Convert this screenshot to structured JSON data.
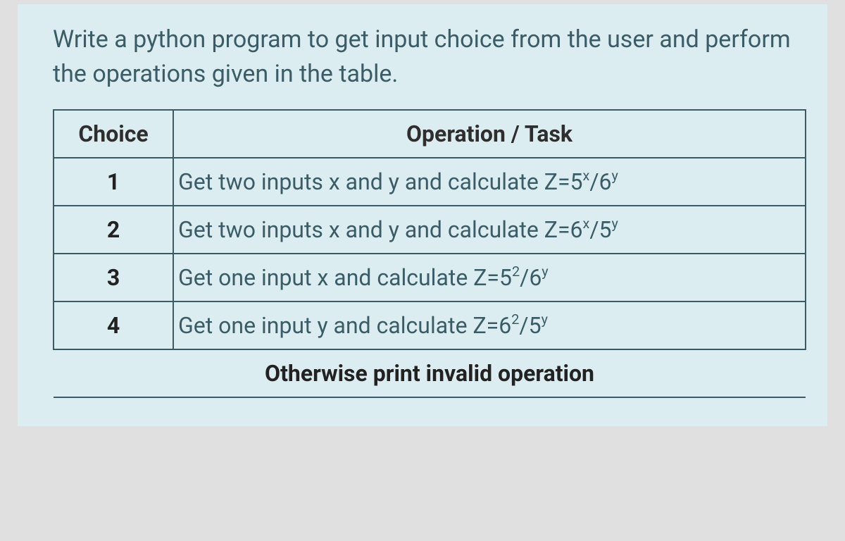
{
  "prompt": "Write a python program to get input choice from the user and perform the operations given in the table.",
  "headers": {
    "choice": "Choice",
    "task": "Operation / Task"
  },
  "rows": [
    {
      "choice": "1",
      "task_prefix": "Get two inputs x and y and calculate Z=5",
      "exp1": "x",
      "mid": "/6",
      "exp2": "y"
    },
    {
      "choice": "2",
      "task_prefix": "Get two inputs x and y and calculate Z=6",
      "exp1": "x",
      "mid": "/5",
      "exp2": "y"
    },
    {
      "choice": "3",
      "task_prefix": "Get one input x and calculate Z=5",
      "exp1": "2",
      "mid": "/6",
      "exp2": "y"
    },
    {
      "choice": "4",
      "task_prefix": "Get one input y and calculate Z=6",
      "exp1": "2",
      "mid": "/5",
      "exp2": "y"
    }
  ],
  "otherwise": "Otherwise print invalid operation"
}
